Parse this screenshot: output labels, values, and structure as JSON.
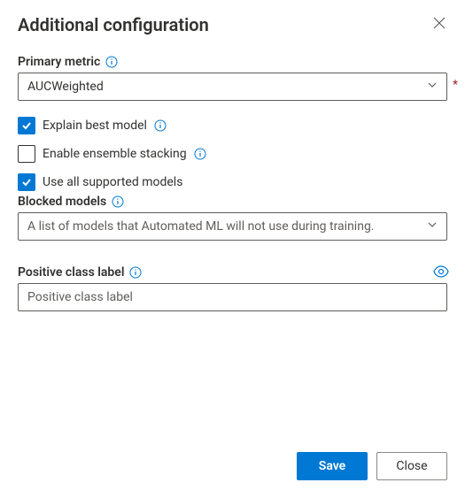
{
  "header": {
    "title": "Additional configuration"
  },
  "primary_metric": {
    "label": "Primary metric",
    "value": "AUCWeighted"
  },
  "checkboxes": {
    "explain_best_model": {
      "label": "Explain best model",
      "checked": true
    },
    "enable_ensemble_stacking": {
      "label": "Enable ensemble stacking",
      "checked": false
    },
    "use_all_supported_models": {
      "label": "Use all supported models",
      "checked": true
    }
  },
  "blocked_models": {
    "label": "Blocked models",
    "placeholder": "A list of models that Automated ML will not use during training."
  },
  "positive_class_label": {
    "label": "Positive class label",
    "placeholder": "Positive class label"
  },
  "footer": {
    "save": "Save",
    "close": "Close"
  }
}
